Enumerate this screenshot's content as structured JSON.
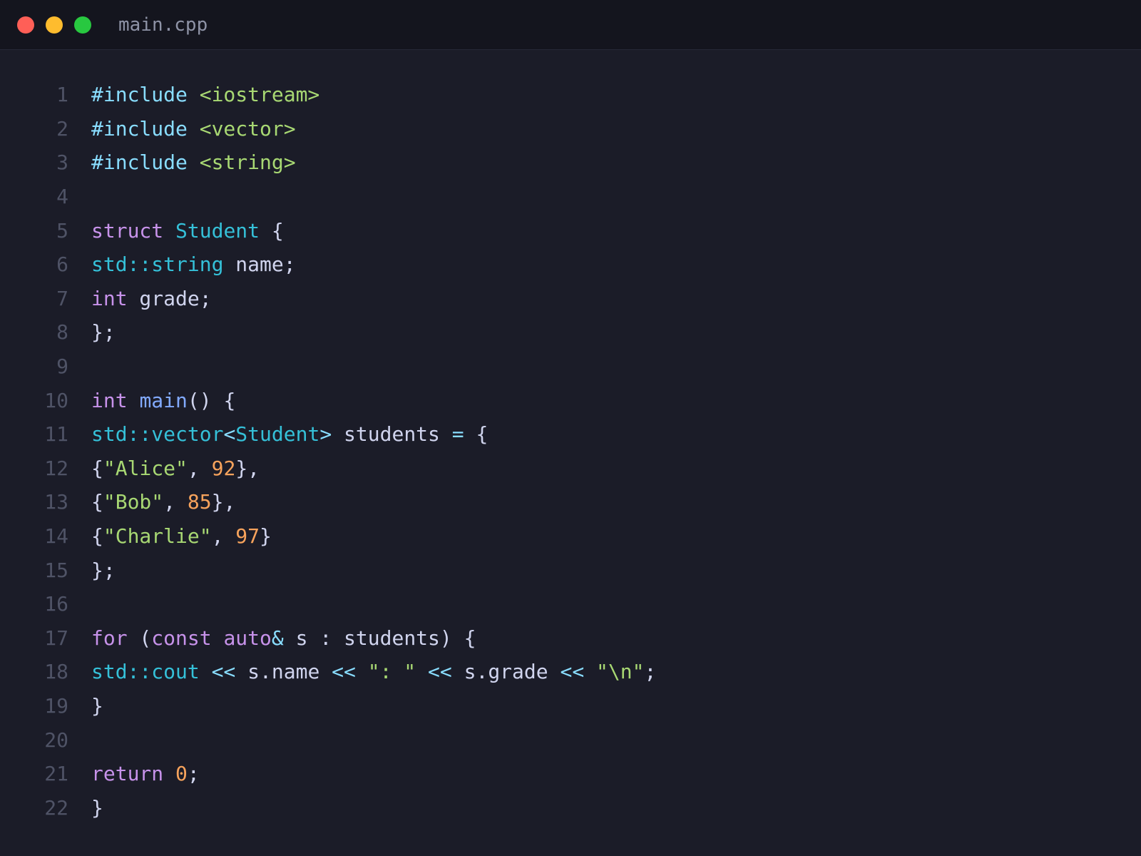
{
  "window": {
    "filename": "main.cpp",
    "buttons": {
      "close": "#ff5f57",
      "minimize": "#febc2e",
      "maximize": "#28c840"
    }
  },
  "theme": {
    "background": "#1b1c28",
    "titlebar": "#14151e",
    "line_number": "#4f5366",
    "preprocessor": "#89ddff",
    "string": "#a8d873",
    "keyword": "#c792ea",
    "type": "#35c0d8",
    "function": "#82aaff",
    "number": "#f7a35c",
    "plain": "#d0d4ee"
  },
  "editor": {
    "lines": [
      {
        "n": "1",
        "tokens": [
          [
            "pp",
            "#include"
          ],
          [
            "pl",
            " "
          ],
          [
            "str",
            "<iostream>"
          ]
        ]
      },
      {
        "n": "2",
        "tokens": [
          [
            "pp",
            "#include"
          ],
          [
            "pl",
            " "
          ],
          [
            "str",
            "<vector>"
          ]
        ]
      },
      {
        "n": "3",
        "tokens": [
          [
            "pp",
            "#include"
          ],
          [
            "pl",
            " "
          ],
          [
            "str",
            "<string>"
          ]
        ]
      },
      {
        "n": "4",
        "tokens": []
      },
      {
        "n": "5",
        "tokens": [
          [
            "kw",
            "struct"
          ],
          [
            "pl",
            " "
          ],
          [
            "ty",
            "Student"
          ],
          [
            "pl",
            " {"
          ]
        ]
      },
      {
        "n": "6",
        "tokens": [
          [
            "ty",
            "std::string"
          ],
          [
            "pl",
            " name;"
          ]
        ]
      },
      {
        "n": "7",
        "tokens": [
          [
            "kw",
            "int"
          ],
          [
            "pl",
            " grade;"
          ]
        ]
      },
      {
        "n": "8",
        "tokens": [
          [
            "pl",
            "};"
          ]
        ]
      },
      {
        "n": "9",
        "tokens": []
      },
      {
        "n": "10",
        "tokens": [
          [
            "kw",
            "int"
          ],
          [
            "pl",
            " "
          ],
          [
            "fn",
            "main"
          ],
          [
            "pl",
            "() {"
          ]
        ]
      },
      {
        "n": "11",
        "tokens": [
          [
            "ty",
            "std::vector"
          ],
          [
            "op",
            "<"
          ],
          [
            "ty",
            "Student"
          ],
          [
            "op",
            ">"
          ],
          [
            "pl",
            " students "
          ],
          [
            "op",
            "="
          ],
          [
            "pl",
            " {"
          ]
        ]
      },
      {
        "n": "12",
        "tokens": [
          [
            "pl",
            "{"
          ],
          [
            "str",
            "\"Alice\""
          ],
          [
            "pl",
            ", "
          ],
          [
            "num",
            "92"
          ],
          [
            "pl",
            "},"
          ]
        ]
      },
      {
        "n": "13",
        "tokens": [
          [
            "pl",
            "{"
          ],
          [
            "str",
            "\"Bob\""
          ],
          [
            "pl",
            ", "
          ],
          [
            "num",
            "85"
          ],
          [
            "pl",
            "},"
          ]
        ]
      },
      {
        "n": "14",
        "tokens": [
          [
            "pl",
            "{"
          ],
          [
            "str",
            "\"Charlie\""
          ],
          [
            "pl",
            ", "
          ],
          [
            "num",
            "97"
          ],
          [
            "pl",
            "}"
          ]
        ]
      },
      {
        "n": "15",
        "tokens": [
          [
            "pl",
            "};"
          ]
        ]
      },
      {
        "n": "16",
        "tokens": []
      },
      {
        "n": "17",
        "tokens": [
          [
            "kw",
            "for"
          ],
          [
            "pl",
            " ("
          ],
          [
            "kw",
            "const"
          ],
          [
            "pl",
            " "
          ],
          [
            "kw",
            "auto"
          ],
          [
            "op",
            "&"
          ],
          [
            "pl",
            " s : students) {"
          ]
        ]
      },
      {
        "n": "18",
        "tokens": [
          [
            "ty",
            "std::cout"
          ],
          [
            "pl",
            " "
          ],
          [
            "op",
            "<<"
          ],
          [
            "pl",
            " s.name "
          ],
          [
            "op",
            "<<"
          ],
          [
            "pl",
            " "
          ],
          [
            "str",
            "\": \""
          ],
          [
            "pl",
            " "
          ],
          [
            "op",
            "<<"
          ],
          [
            "pl",
            " s.grade "
          ],
          [
            "op",
            "<<"
          ],
          [
            "pl",
            " "
          ],
          [
            "str",
            "\"\\n\""
          ],
          [
            "pl",
            ";"
          ]
        ]
      },
      {
        "n": "19",
        "tokens": [
          [
            "pl",
            "}"
          ]
        ]
      },
      {
        "n": "20",
        "tokens": []
      },
      {
        "n": "21",
        "tokens": [
          [
            "kw",
            "return"
          ],
          [
            "pl",
            " "
          ],
          [
            "num",
            "0"
          ],
          [
            "pl",
            ";"
          ]
        ]
      },
      {
        "n": "22",
        "tokens": [
          [
            "pl",
            "}"
          ]
        ]
      }
    ]
  }
}
